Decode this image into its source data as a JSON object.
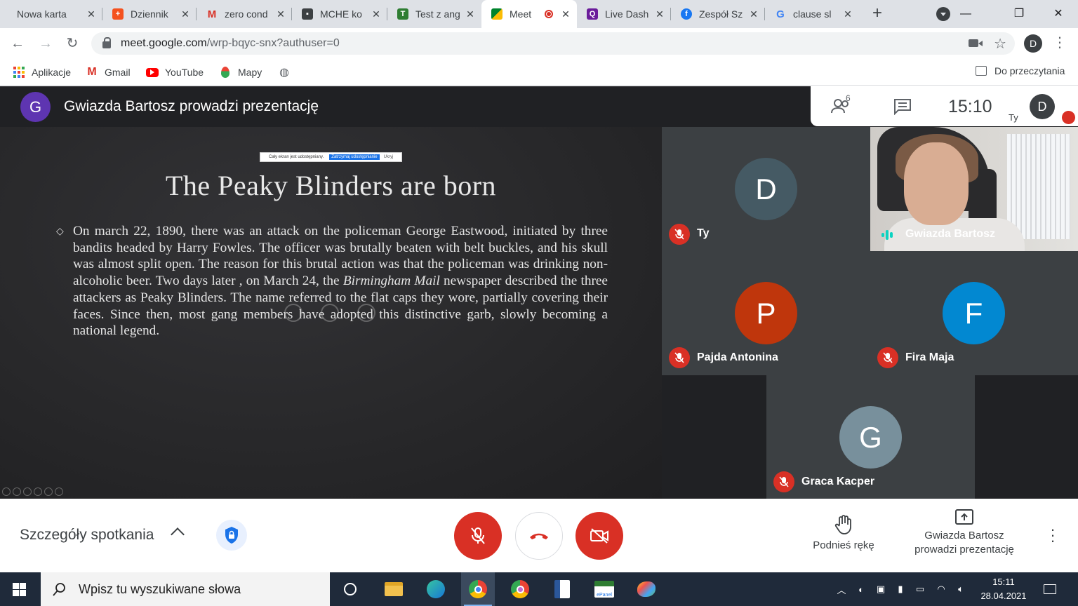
{
  "browser": {
    "tabs": [
      {
        "title": "Nowa karta",
        "favicon": "blank-icon"
      },
      {
        "title": "Dziennik",
        "favicon": "dziennik-icon"
      },
      {
        "title": "zero cond",
        "favicon": "gmail-icon"
      },
      {
        "title": "MCHE ko",
        "favicon": "classroom-icon"
      },
      {
        "title": "Test z ang",
        "favicon": "testportal-icon"
      },
      {
        "title": "Meet",
        "favicon": "meet-icon",
        "recording": true
      },
      {
        "title": "Live Dash",
        "favicon": "quizizz-icon"
      },
      {
        "title": "Zespół Sz",
        "favicon": "facebook-icon"
      },
      {
        "title": "clause sl",
        "favicon": "google-icon"
      }
    ],
    "new_tab": "+",
    "url_host": "meet.google.com",
    "url_rest": "/wrp-bqyc-snx?authuser=0",
    "profile_initial": "D",
    "bookmarks": [
      {
        "label": "Aplikacje",
        "icon": "apps-grid-icon"
      },
      {
        "label": "Gmail",
        "icon": "gmail-icon"
      },
      {
        "label": "YouTube",
        "icon": "youtube-icon"
      },
      {
        "label": "Mapy",
        "icon": "maps-icon"
      },
      {
        "label": "",
        "icon": "globe-icon"
      }
    ],
    "reading_list": "Do przeczytania"
  },
  "meet": {
    "presenter_initial": "G",
    "presenting_title": "Gwiazda Bartosz prowadzi prezentację",
    "participants_count": "6",
    "time": "15:10",
    "self_label": "Ty",
    "self_initial": "D",
    "slide": {
      "share_notice": "Cały ekran jest udostępniany.",
      "share_stop": "Zatrzymaj udostępnianie",
      "share_hide": "Ukryj",
      "title": "The Peaky Blinders are born",
      "body_1": "On march 22, 1890, there was an attack on the policeman George Eastwood, initiated by three bandits headed by Harry Fowles. The officer was brutally beaten with belt buckles, and his skull was almost split open. The reason for this brutal action was that the policeman was drinking non-alcoholic beer. Two days later , on March 24, the ",
      "body_italic": "Birmingham Mail",
      "body_2": " newspaper described the three attackers as Peaky Blinders. The name referred to the flat caps they wore, partially covering their faces. Since then, most gang members have adopted this distinctive garb, slowly becoming a national legend."
    },
    "tiles": [
      {
        "name": "Ty",
        "initial": "D",
        "color": "#455a64",
        "muted": true
      },
      {
        "name": "Gwiazda Bartosz",
        "camera": true,
        "speaking": true
      },
      {
        "name": "Pajda Antonina",
        "initial": "P",
        "color": "#bf360c",
        "muted": true
      },
      {
        "name": "Fira Maja",
        "initial": "F",
        "color": "#0288d1",
        "muted": true
      },
      {
        "name": "Graca Kacper",
        "initial": "G",
        "color": "#78909c",
        "muted": true
      }
    ],
    "controls": {
      "details": "Szczegóły spotkania",
      "raise_hand": "Podnieś rękę",
      "presenting_line1": "Gwiazda Bartosz",
      "presenting_line2": "prowadzi prezentację"
    }
  },
  "taskbar": {
    "search_placeholder": "Wpisz tu wyszukiwane słowa",
    "time": "15:11",
    "date": "28.04.2021"
  },
  "colors": {
    "meet_bg": "#202124",
    "danger": "#d93025",
    "accent": "#1a73e8"
  }
}
